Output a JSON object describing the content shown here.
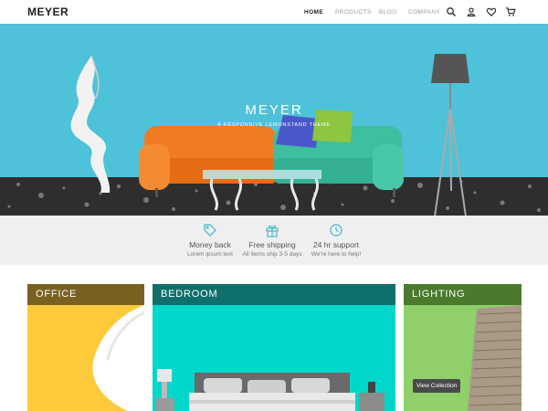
{
  "header": {
    "logo": "MEYER",
    "nav": [
      {
        "label": "HOME",
        "active": true
      },
      {
        "label": "PRODUCTS",
        "active": false
      },
      {
        "label": "BLOG",
        "active": false
      },
      {
        "label": "COMPANY",
        "active": false
      }
    ],
    "icons": [
      "search-icon",
      "user-icon",
      "heart-icon",
      "cart-icon"
    ]
  },
  "hero": {
    "title": "MEYER",
    "subtitle": "A RESPONSIVE LEMONSTAND THEME"
  },
  "features": [
    {
      "icon": "tag-icon",
      "title": "Money back",
      "subtitle": "Lorem ipsum text"
    },
    {
      "icon": "gift-icon",
      "title": "Free shipping",
      "subtitle": "All items ship 3-5 days"
    },
    {
      "icon": "clock-icon",
      "title": "24 hr support",
      "subtitle": "We're here to help!"
    }
  ],
  "categories": [
    {
      "label": "OFFICE",
      "header_color": "#7a6120",
      "body_color": "#ffc93c"
    },
    {
      "label": "BEDROOM",
      "header_color": "#0f6f6b",
      "body_color": "#00d8cc"
    },
    {
      "label": "LIGHTING",
      "header_color": "#4a7a2e",
      "body_color": "#8fd06a",
      "button": "View Collection"
    }
  ],
  "colors": {
    "accent": "#40b8c8",
    "hero_bg": "#4ec2d8"
  }
}
